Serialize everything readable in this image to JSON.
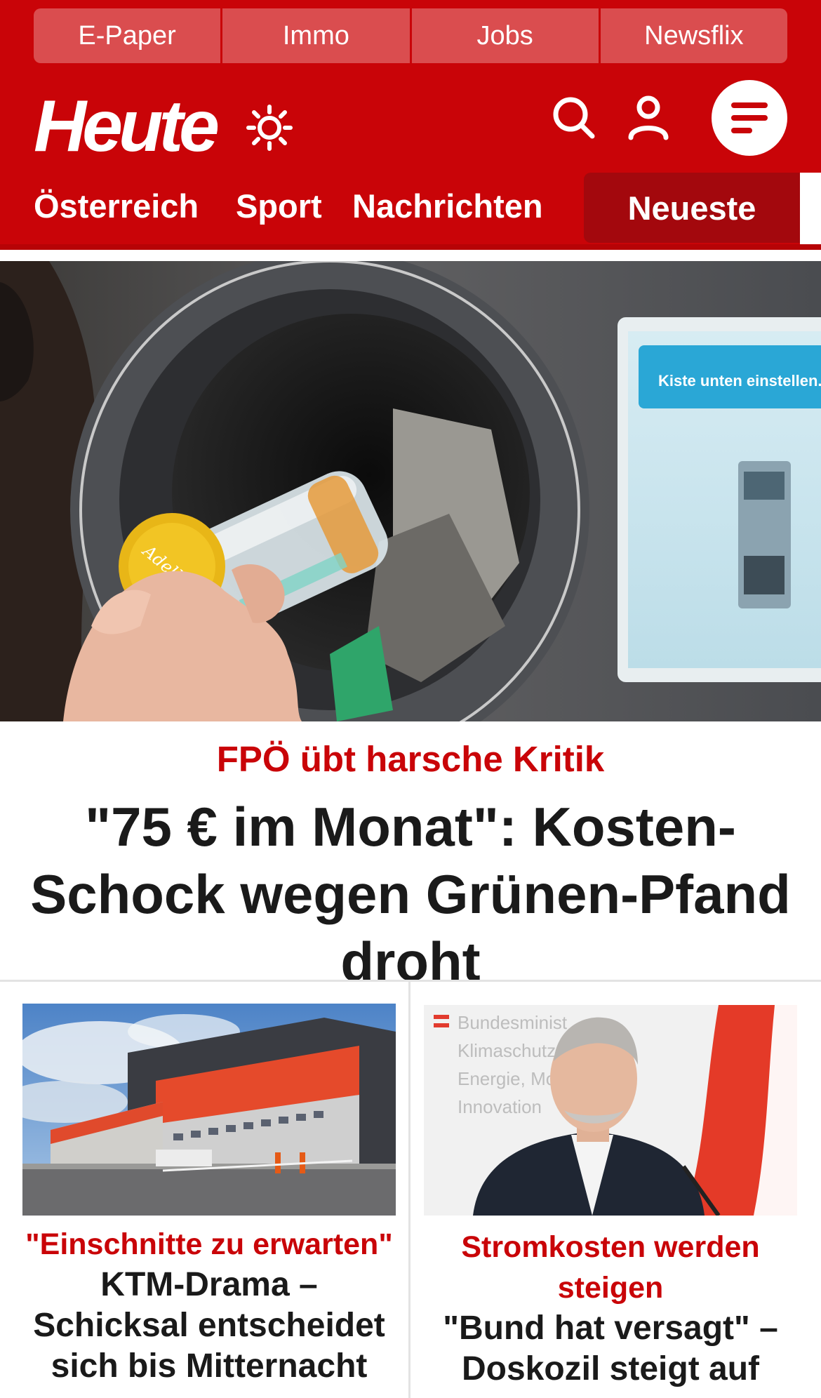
{
  "top_nav": [
    "E-Paper",
    "Immo",
    "Jobs",
    "Newsflix"
  ],
  "brand": {
    "logo_text": "Heute",
    "primary_color": "#c90408"
  },
  "header_icons": [
    "sun-icon",
    "search-icon",
    "user-icon",
    "menu-icon"
  ],
  "sections": {
    "items": [
      "Österreich",
      "Sport",
      "Nachrichten"
    ],
    "active": "Neueste"
  },
  "hero": {
    "kicker": "FPÖ übt harsche Kritik",
    "title": "\"75 € im Monat\": Kosten-Schock wegen Grünen-Pfand droht",
    "image_caption_text": "Kiste unten einstellen."
  },
  "cards": [
    {
      "kicker": "\"Einschnitte zu erwarten\"",
      "title": "KTM-Drama – Schicksal entscheidet sich bis Mitternacht"
    },
    {
      "kicker": "Stromkosten werden steigen",
      "title": "\"Bund hat versagt\" – Doskozil steigt auf"
    }
  ]
}
